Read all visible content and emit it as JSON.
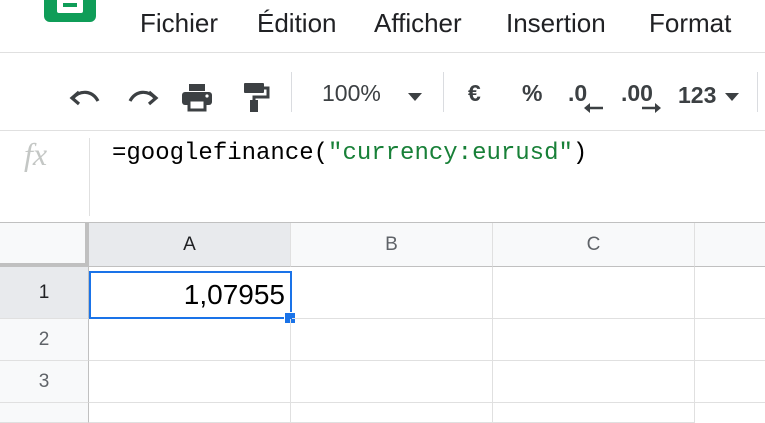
{
  "app": {
    "logo_icon": "sheets-logo-icon",
    "brand_color": "#0f9d58"
  },
  "menu": {
    "items": [
      "Fichier",
      "Édition",
      "Afficher",
      "Insertion",
      "Format"
    ]
  },
  "toolbar": {
    "icons": [
      "undo-icon",
      "redo-icon",
      "print-icon",
      "paint-format-icon"
    ],
    "zoom": "100%",
    "currency": "€",
    "percent": "%",
    "decrease_decimals": ".0",
    "increase_decimals": ".00",
    "more_formats": "123"
  },
  "formula_bar": {
    "fx_label": "fx",
    "prefix": "=googlefinance(",
    "string_arg": "\"currency:eurusd\"",
    "suffix": ")",
    "string_color": "#188038"
  },
  "grid": {
    "columns": [
      "A",
      "B",
      "C"
    ],
    "rows": [
      "1",
      "2",
      "3"
    ],
    "selected_cell": "A1",
    "selection_color": "#1a73e8",
    "cells": {
      "A1": "1,07955"
    }
  }
}
